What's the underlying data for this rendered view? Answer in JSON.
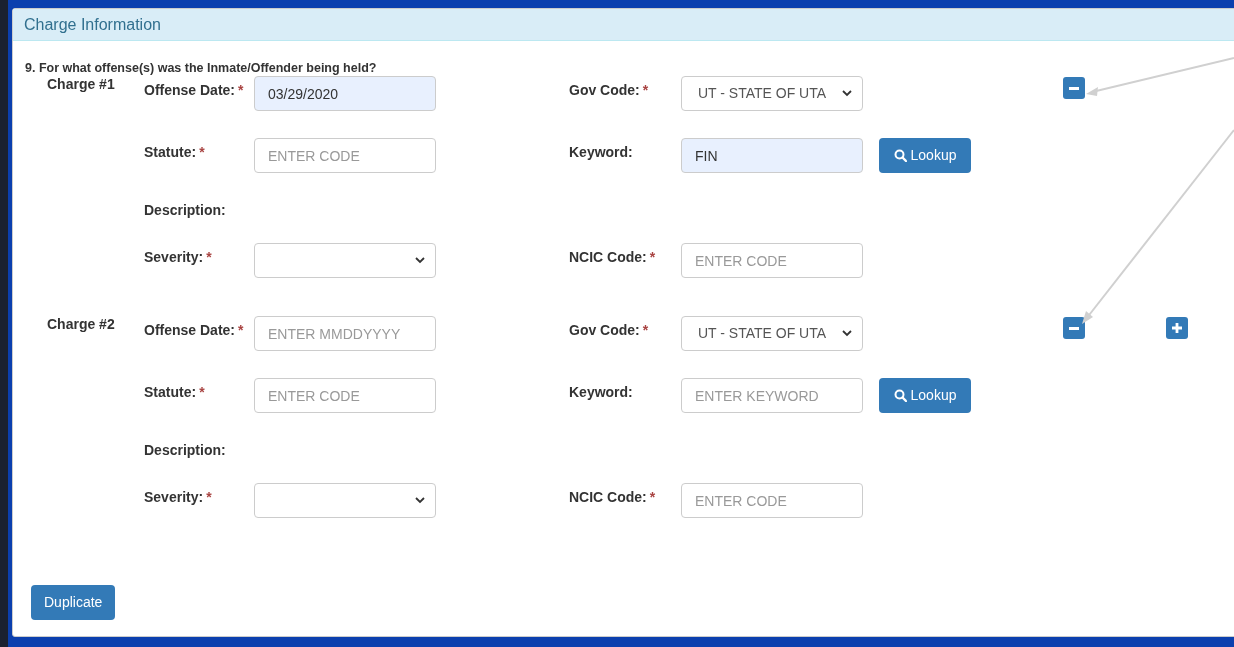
{
  "panel": {
    "title": "Charge Information"
  },
  "question": "9. For what offense(s) was the Inmate/Offender being held?",
  "charges": [
    {
      "label": "Charge #1",
      "actions": [
        {
          "kind": "remove"
        }
      ],
      "rows": [
        {
          "left": {
            "label": "Offense Date:",
            "required_mark": "*",
            "kind": "input",
            "value": "03/29/2020",
            "autofilled": true
          },
          "right": {
            "label": "Gov Code:",
            "required_mark": "*",
            "kind": "select",
            "value": "UT - STATE OF UTA"
          }
        },
        {
          "left": {
            "label": "Statute:",
            "required_mark": "*",
            "kind": "input",
            "placeholder": "ENTER CODE",
            "autofilled": false
          },
          "right": {
            "label": "Keyword:",
            "kind": "input",
            "value": "FIN",
            "autofilled": true,
            "button": {
              "label": "Lookup"
            }
          }
        },
        {
          "left": {
            "label": "Description:",
            "kind": "text"
          }
        },
        {
          "left": {
            "label": "Severity:",
            "required_mark": "*",
            "kind": "select"
          },
          "right": {
            "label": "NCIC Code:",
            "required_mark": "*",
            "kind": "input",
            "placeholder": "ENTER CODE",
            "autofilled": false
          }
        }
      ]
    },
    {
      "label": "Charge #2",
      "actions": [
        {
          "kind": "remove"
        },
        {
          "kind": "add"
        }
      ],
      "rows": [
        {
          "left": {
            "label": "Offense Date:",
            "required_mark": "*",
            "kind": "input",
            "placeholder": "ENTER MMDDYYYY",
            "autofilled": false
          },
          "right": {
            "label": "Gov Code:",
            "required_mark": "*",
            "kind": "select",
            "value": "UT - STATE OF UTA"
          }
        },
        {
          "left": {
            "label": "Statute:",
            "required_mark": "*",
            "kind": "input",
            "placeholder": "ENTER CODE",
            "autofilled": false
          },
          "right": {
            "label": "Keyword:",
            "kind": "input",
            "placeholder": "ENTER KEYWORD",
            "autofilled": false,
            "button": {
              "label": "Lookup"
            }
          }
        },
        {
          "left": {
            "label": "Description:",
            "kind": "text"
          }
        },
        {
          "left": {
            "label": "Severity:",
            "required_mark": "*",
            "kind": "select"
          },
          "right": {
            "label": "NCIC Code:",
            "required_mark": "*",
            "kind": "input",
            "placeholder": "ENTER CODE",
            "autofilled": false
          }
        }
      ]
    }
  ],
  "footer_button": {
    "label": "Duplicate"
  }
}
